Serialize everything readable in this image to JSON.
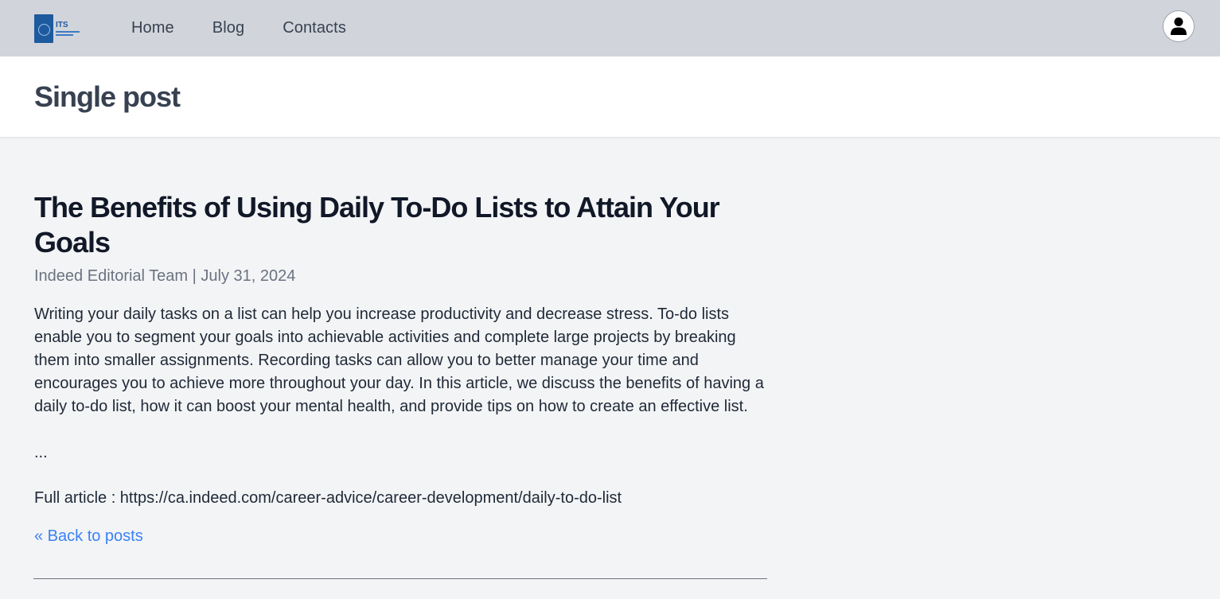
{
  "nav": {
    "logo_text": "ITS",
    "links": [
      "Home",
      "Blog",
      "Contacts"
    ]
  },
  "header": {
    "title": "Single post"
  },
  "post": {
    "title": "The Benefits of Using Daily To-Do Lists to Attain Your Goals",
    "author": "Indeed Editorial Team",
    "separator": " | ",
    "date": "July 31, 2024",
    "body": "Writing your daily tasks on a list can help you increase productivity and decrease stress. To-do lists enable you to segment your goals into achievable activities and complete large projects by breaking them into smaller assignments. Recording tasks can allow you to better manage your time and encourages you to achieve more throughout your day. In this article, we discuss the benefits of having a daily to-do list, how it can boost your mental health, and provide tips on how to create an effective list.",
    "ellipsis": "...",
    "full_article": "Full article : https://ca.indeed.com/career-advice/career-development/daily-to-do-list",
    "back_label": "« Back to posts"
  },
  "colors": {
    "nav_bg": "#d1d5db",
    "page_bg": "#f3f4f6",
    "link": "#3b82f6"
  }
}
